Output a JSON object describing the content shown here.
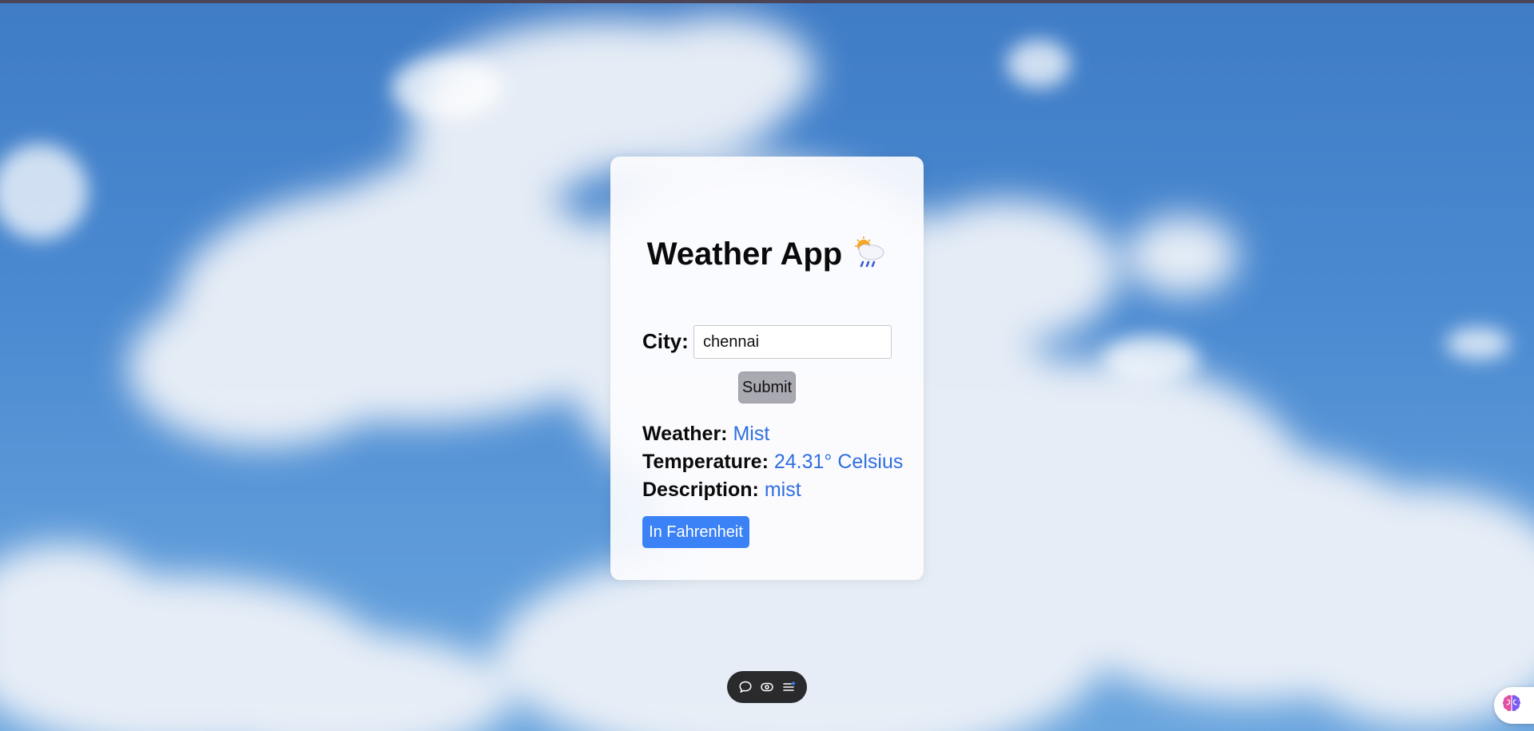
{
  "app": {
    "title": "Weather App"
  },
  "form": {
    "city_label": "City:",
    "city_value": "chennai",
    "submit_label": "Submit"
  },
  "result": {
    "weather_label": "Weather:",
    "weather_value": "Mist",
    "temperature_label": "Temperature:",
    "temperature_value": "24.31° Celsius",
    "description_label": "Description:",
    "description_value": "mist",
    "convert_label": "In Fahrenheit"
  },
  "icons": {
    "title_emoji": "sun-behind-rain-cloud-icon",
    "toolbar": [
      "comment-icon",
      "eye-icon",
      "menu-icon"
    ],
    "assistant": "brain-icon"
  },
  "colors": {
    "value_text": "#2f6fde",
    "primary_button": "#3b82f6",
    "submit_button": "#a9a9b2",
    "sky": "#4a89d0"
  }
}
